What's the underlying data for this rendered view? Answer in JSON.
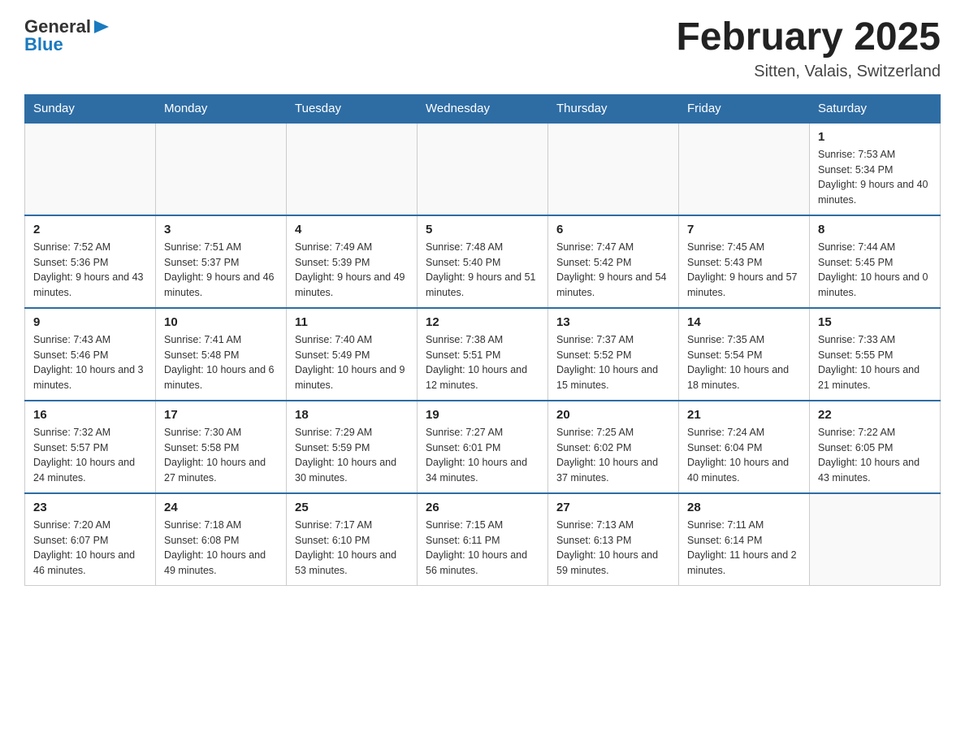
{
  "header": {
    "logo_general": "General",
    "logo_blue": "Blue",
    "title": "February 2025",
    "location": "Sitten, Valais, Switzerland"
  },
  "days_of_week": [
    "Sunday",
    "Monday",
    "Tuesday",
    "Wednesday",
    "Thursday",
    "Friday",
    "Saturday"
  ],
  "weeks": [
    {
      "days": [
        {
          "number": "",
          "info": ""
        },
        {
          "number": "",
          "info": ""
        },
        {
          "number": "",
          "info": ""
        },
        {
          "number": "",
          "info": ""
        },
        {
          "number": "",
          "info": ""
        },
        {
          "number": "",
          "info": ""
        },
        {
          "number": "1",
          "info": "Sunrise: 7:53 AM\nSunset: 5:34 PM\nDaylight: 9 hours and 40 minutes."
        }
      ]
    },
    {
      "days": [
        {
          "number": "2",
          "info": "Sunrise: 7:52 AM\nSunset: 5:36 PM\nDaylight: 9 hours and 43 minutes."
        },
        {
          "number": "3",
          "info": "Sunrise: 7:51 AM\nSunset: 5:37 PM\nDaylight: 9 hours and 46 minutes."
        },
        {
          "number": "4",
          "info": "Sunrise: 7:49 AM\nSunset: 5:39 PM\nDaylight: 9 hours and 49 minutes."
        },
        {
          "number": "5",
          "info": "Sunrise: 7:48 AM\nSunset: 5:40 PM\nDaylight: 9 hours and 51 minutes."
        },
        {
          "number": "6",
          "info": "Sunrise: 7:47 AM\nSunset: 5:42 PM\nDaylight: 9 hours and 54 minutes."
        },
        {
          "number": "7",
          "info": "Sunrise: 7:45 AM\nSunset: 5:43 PM\nDaylight: 9 hours and 57 minutes."
        },
        {
          "number": "8",
          "info": "Sunrise: 7:44 AM\nSunset: 5:45 PM\nDaylight: 10 hours and 0 minutes."
        }
      ]
    },
    {
      "days": [
        {
          "number": "9",
          "info": "Sunrise: 7:43 AM\nSunset: 5:46 PM\nDaylight: 10 hours and 3 minutes."
        },
        {
          "number": "10",
          "info": "Sunrise: 7:41 AM\nSunset: 5:48 PM\nDaylight: 10 hours and 6 minutes."
        },
        {
          "number": "11",
          "info": "Sunrise: 7:40 AM\nSunset: 5:49 PM\nDaylight: 10 hours and 9 minutes."
        },
        {
          "number": "12",
          "info": "Sunrise: 7:38 AM\nSunset: 5:51 PM\nDaylight: 10 hours and 12 minutes."
        },
        {
          "number": "13",
          "info": "Sunrise: 7:37 AM\nSunset: 5:52 PM\nDaylight: 10 hours and 15 minutes."
        },
        {
          "number": "14",
          "info": "Sunrise: 7:35 AM\nSunset: 5:54 PM\nDaylight: 10 hours and 18 minutes."
        },
        {
          "number": "15",
          "info": "Sunrise: 7:33 AM\nSunset: 5:55 PM\nDaylight: 10 hours and 21 minutes."
        }
      ]
    },
    {
      "days": [
        {
          "number": "16",
          "info": "Sunrise: 7:32 AM\nSunset: 5:57 PM\nDaylight: 10 hours and 24 minutes."
        },
        {
          "number": "17",
          "info": "Sunrise: 7:30 AM\nSunset: 5:58 PM\nDaylight: 10 hours and 27 minutes."
        },
        {
          "number": "18",
          "info": "Sunrise: 7:29 AM\nSunset: 5:59 PM\nDaylight: 10 hours and 30 minutes."
        },
        {
          "number": "19",
          "info": "Sunrise: 7:27 AM\nSunset: 6:01 PM\nDaylight: 10 hours and 34 minutes."
        },
        {
          "number": "20",
          "info": "Sunrise: 7:25 AM\nSunset: 6:02 PM\nDaylight: 10 hours and 37 minutes."
        },
        {
          "number": "21",
          "info": "Sunrise: 7:24 AM\nSunset: 6:04 PM\nDaylight: 10 hours and 40 minutes."
        },
        {
          "number": "22",
          "info": "Sunrise: 7:22 AM\nSunset: 6:05 PM\nDaylight: 10 hours and 43 minutes."
        }
      ]
    },
    {
      "days": [
        {
          "number": "23",
          "info": "Sunrise: 7:20 AM\nSunset: 6:07 PM\nDaylight: 10 hours and 46 minutes."
        },
        {
          "number": "24",
          "info": "Sunrise: 7:18 AM\nSunset: 6:08 PM\nDaylight: 10 hours and 49 minutes."
        },
        {
          "number": "25",
          "info": "Sunrise: 7:17 AM\nSunset: 6:10 PM\nDaylight: 10 hours and 53 minutes."
        },
        {
          "number": "26",
          "info": "Sunrise: 7:15 AM\nSunset: 6:11 PM\nDaylight: 10 hours and 56 minutes."
        },
        {
          "number": "27",
          "info": "Sunrise: 7:13 AM\nSunset: 6:13 PM\nDaylight: 10 hours and 59 minutes."
        },
        {
          "number": "28",
          "info": "Sunrise: 7:11 AM\nSunset: 6:14 PM\nDaylight: 11 hours and 2 minutes."
        },
        {
          "number": "",
          "info": ""
        }
      ]
    }
  ]
}
